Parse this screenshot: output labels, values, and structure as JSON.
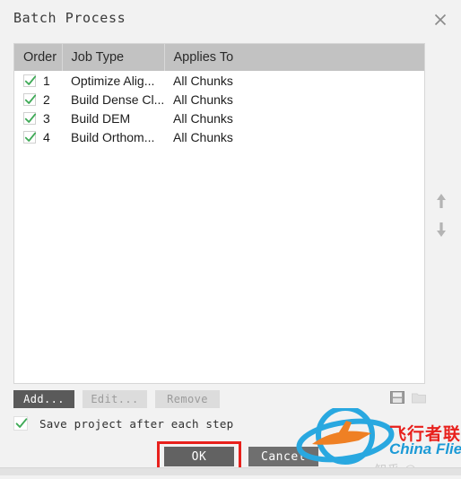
{
  "window": {
    "title": "Batch Process",
    "close_icon": "close-icon"
  },
  "table": {
    "columns": [
      "Order",
      "Job Type",
      "Applies To"
    ],
    "rows": [
      {
        "checked": true,
        "order": "1",
        "job_type": "Optimize Alig...",
        "applies_to": "All Chunks"
      },
      {
        "checked": true,
        "order": "2",
        "job_type": "Build Dense Cl...",
        "applies_to": "All Chunks"
      },
      {
        "checked": true,
        "order": "3",
        "job_type": "Build DEM",
        "applies_to": "All Chunks"
      },
      {
        "checked": true,
        "order": "4",
        "job_type": "Build Orthom...",
        "applies_to": "All Chunks"
      }
    ]
  },
  "reorder": {
    "up_icon": "arrow-up-icon",
    "down_icon": "arrow-down-icon"
  },
  "file_icons": {
    "save_icon": "save-disk-icon",
    "open_icon": "open-folder-icon"
  },
  "buttons": {
    "add": "Add...",
    "edit": "Edit...",
    "remove": "Remove"
  },
  "options": {
    "save_project_label": "Save project after each step",
    "save_project_checked": true
  },
  "dialog_buttons": {
    "ok": "OK",
    "cancel": "Cancel"
  },
  "annotation": {
    "highlight_color": "#e8201c",
    "target": "ok-button"
  },
  "watermark": {
    "chinese": "飞行者联盟",
    "english": "China Flier",
    "ghost": "知乎 @ sanm",
    "logo_icon": "airplane-orbit-logo-icon",
    "accent_blue": "#1b9ad6",
    "accent_orange": "#ef8024"
  },
  "colors": {
    "dialog_bg": "#f2f2f2",
    "header_bg": "#c2c2c2",
    "list_bg": "#ffffff",
    "check_green": "#3faa57",
    "button_enabled": "#5a5a5a",
    "button_disabled": "#dcdcdc"
  }
}
